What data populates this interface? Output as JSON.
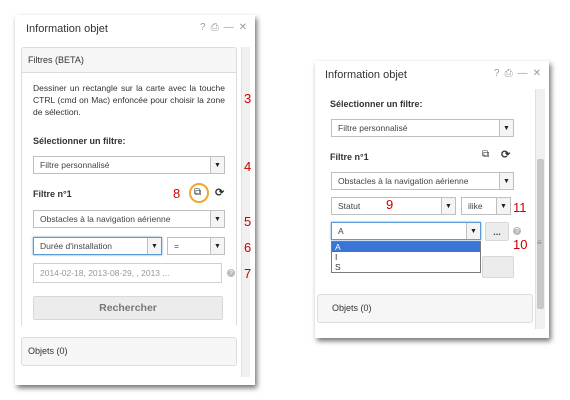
{
  "left": {
    "title": "Information objet",
    "icons": [
      "help-icon",
      "print-icon",
      "minimize-icon",
      "close-icon"
    ],
    "filters_header": "Filtres (BETA)",
    "description": "Dessiner un rectangle sur la carte avec la touche CTRL (cmd on Mac) enfoncée pour choisir la zone de sélection.",
    "select_filter_label": "Sélectionner un filtre:",
    "filter_select_value": "Filtre personnalisé",
    "filter_heading": "Filtre n°1",
    "layer_select_value": "Obstacles à la navigation aérienne",
    "attribute_select_value": "Durée d'installation",
    "operator_select_value": "=",
    "value_placeholder": "2014-02-18, 2013-08-29, , 2013 ...",
    "search_button": "Rechercher",
    "objects_header": "Objets (0)",
    "annotations": [
      "3",
      "4",
      "5",
      "6",
      "7",
      "8"
    ]
  },
  "right": {
    "title": "Information objet",
    "icons": [
      "help-icon",
      "print-icon",
      "minimize-icon",
      "close-icon"
    ],
    "select_filter_label": "Sélectionner un filtre:",
    "filter_select_value": "Filtre personnalisé",
    "filter_heading": "Filtre n°1",
    "layer_select_value": "Obstacles à la navigation aérienne",
    "attribute_select_value": "Statut",
    "operator_select_value": "ilike",
    "value_select_value": "A",
    "dropdown_options": [
      "A",
      "I",
      "S"
    ],
    "more_button": "...",
    "objects_header": "Objets (0)",
    "annotations": [
      "9",
      "10",
      "11"
    ]
  },
  "colors": {
    "annotation": "#cc0000",
    "highlight_ring": "#f0a830",
    "selected_option": "#3875d7"
  }
}
